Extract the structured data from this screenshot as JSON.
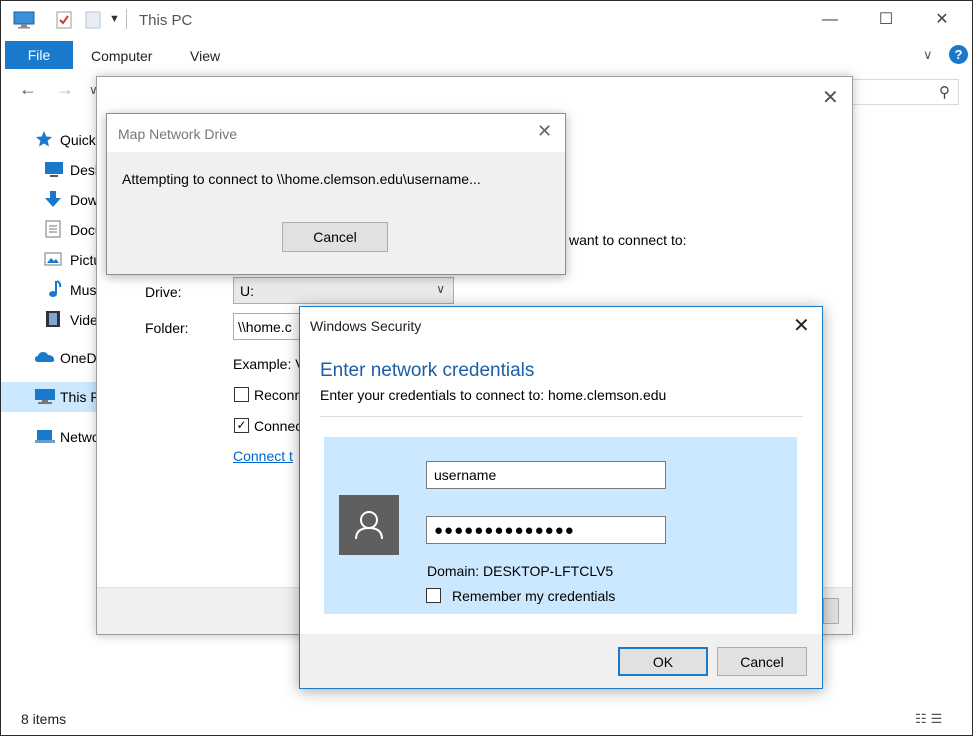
{
  "explorer": {
    "title": "This PC",
    "window_controls": {
      "minimize": "—",
      "maximize": "☐",
      "close": "✕"
    },
    "ribbon": {
      "file_tab": "File",
      "tabs": [
        "Computer",
        "View"
      ],
      "help_icon_glyph": "?",
      "collapse_glyph": "∨"
    },
    "nav_arrows": {
      "back": "←",
      "forward": "→",
      "recent": "∨"
    },
    "search_icon_glyph": "⚲",
    "nav_pane": [
      {
        "label": "Quick",
        "icon": "star-icon",
        "selected": false
      },
      {
        "label": "Desk",
        "icon": "desktop-icon",
        "selected": false
      },
      {
        "label": "Dow",
        "icon": "download-icon",
        "selected": false
      },
      {
        "label": "Docu",
        "icon": "document-icon",
        "selected": false
      },
      {
        "label": "Pictu",
        "icon": "pictures-icon",
        "selected": false
      },
      {
        "label": "Mus",
        "icon": "music-icon",
        "selected": false
      },
      {
        "label": "Vide",
        "icon": "video-icon",
        "selected": false
      },
      {
        "label": "OneD",
        "icon": "onedrive-icon",
        "selected": false
      },
      {
        "label": "This P",
        "icon": "computer-icon",
        "selected": true
      },
      {
        "label": "Netwo",
        "icon": "network-icon",
        "selected": false
      }
    ],
    "status_text": "8 items",
    "view_icons_glyph": "☷☰",
    "accent_color": "#1979ca",
    "selection_color": "#cce8ff"
  },
  "wizard": {
    "close_glyph": "✕",
    "connect_to_text": "want to connect to:",
    "drive_label": "Drive:",
    "drive_value": "U:",
    "dropdown_glyph": "∨",
    "folder_label": "Folder:",
    "folder_value": "\\\\home.c",
    "example_text": "Example: V",
    "reconnect_label": "Reconn",
    "reconnect_checked": false,
    "connect_creds_label": "Connec",
    "connect_creds_checked": true,
    "check_glyph": "✓",
    "link_text": "Connect t"
  },
  "connect_dialog": {
    "title": "Map Network Drive",
    "close_glyph": "✕",
    "message": "Attempting to connect to \\\\home.clemson.edu\\username...",
    "cancel_label": "Cancel"
  },
  "security_dialog": {
    "title": "Windows Security",
    "close_glyph": "✕",
    "heading": "Enter network credentials",
    "subheading": "Enter your credentials to connect to: home.clemson.edu",
    "username_value": "username",
    "password_value": "●●●●●●●●●●●●●●",
    "domain_text": "Domain: DESKTOP-LFTCLV5",
    "remember_label": "Remember my credentials",
    "remember_checked": false,
    "ok_label": "OK",
    "cancel_label": "Cancel",
    "heading_color": "#1c5ea8",
    "panel_color": "#cce8ff"
  }
}
